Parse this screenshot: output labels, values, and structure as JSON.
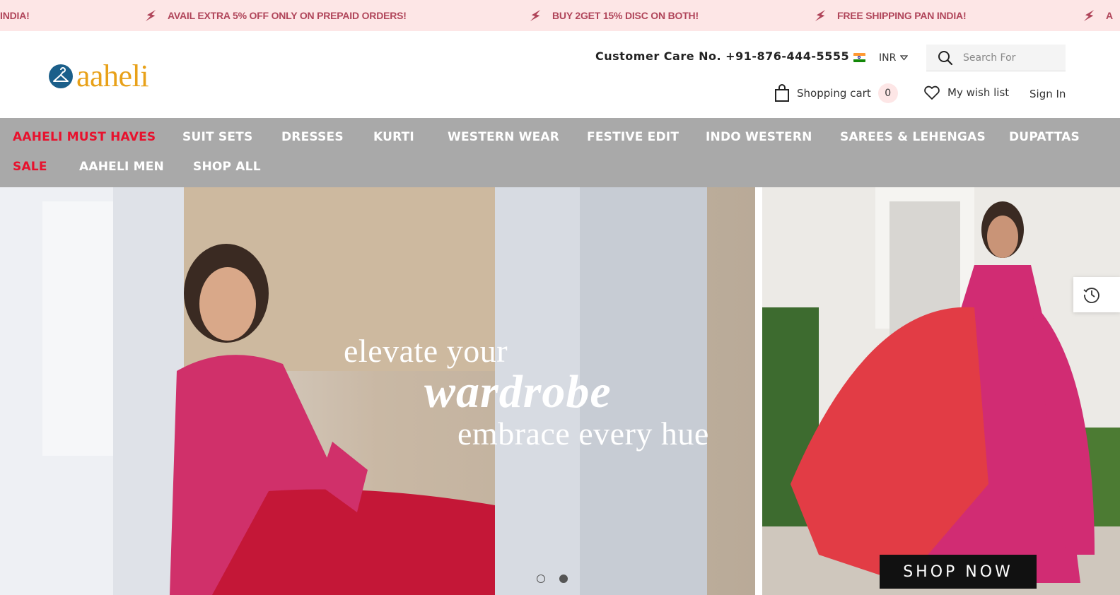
{
  "announcements": [
    "INDIA!",
    "AVAIL EXTRA 5% OFF ONLY ON PREPAID ORDERS!",
    "BUY 2GET 15% DISC ON BOTH!",
    "FREE SHIPPING PAN INDIA!",
    "A"
  ],
  "header": {
    "logo_text": "aaheli",
    "customer_care": "Customer Care No. +91-876-444-5555",
    "currency": "INR",
    "search_placeholder": "Search For",
    "cart_label": "Shopping cart",
    "cart_count": "0",
    "wishlist_label": "My wish list",
    "signin_label": "Sign In"
  },
  "nav": {
    "items": [
      {
        "label": "AAHELI MUST HAVES",
        "color": "#e8112d"
      },
      {
        "label": "SUIT SETS"
      },
      {
        "label": "DRESSES"
      },
      {
        "label": "KURTI"
      },
      {
        "label": "WESTERN WEAR"
      },
      {
        "label": "FESTIVE EDIT"
      },
      {
        "label": "INDO WESTERN"
      },
      {
        "label": "SAREES & LEHENGAS"
      },
      {
        "label": "DUPATTAS"
      },
      {
        "label": "SALE",
        "color": "#e8112d"
      },
      {
        "label": "AAHELI MEN"
      },
      {
        "label": "SHOP ALL"
      }
    ]
  },
  "hero": {
    "line1": "elevate your",
    "line2": "wardrobe",
    "line3": "embrace every hue",
    "cta": "SHOP NOW"
  },
  "colors": {
    "announce_bg": "#fde6e6",
    "announce_text": "#b0455a",
    "nav_bg": "#a9a9a9",
    "brand_gold": "#e8a119",
    "brand_blue": "#1b5f8a"
  }
}
